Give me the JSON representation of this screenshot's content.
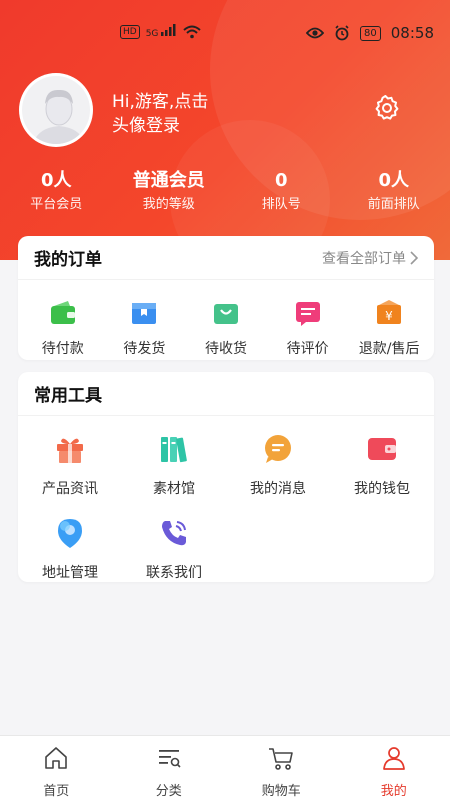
{
  "status_bar": {
    "time": "08:58",
    "left_badge": "HD",
    "signal_label": "5G",
    "battery": "80",
    "icons": [
      "eye-icon",
      "alarm-icon",
      "battery-icon",
      "wifi-icon",
      "signal-icon"
    ]
  },
  "profile": {
    "greeting_line1": "Hi,游客,点击",
    "greeting_line2": "头像登录"
  },
  "stats": [
    {
      "value": "0人",
      "label": "平台会员"
    },
    {
      "value": "普通会员",
      "label": "我的等级"
    },
    {
      "value": "0",
      "label": "排队号"
    },
    {
      "value": "0人",
      "label": "前面排队"
    }
  ],
  "orders": {
    "title": "我的订单",
    "view_all": "查看全部订单",
    "items": [
      {
        "label": "待付款",
        "icon": "wallet-icon",
        "color": "#3cbf4a"
      },
      {
        "label": "待发货",
        "icon": "box-icon",
        "color": "#3a8ff0"
      },
      {
        "label": "待收货",
        "icon": "bag-icon",
        "color": "#44c28a"
      },
      {
        "label": "待评价",
        "icon": "comment-icon",
        "color": "#ef3d7a"
      },
      {
        "label": "退款/售后",
        "icon": "refund-icon",
        "color": "#f0831e"
      }
    ]
  },
  "tools": {
    "title": "常用工具",
    "items": [
      {
        "label": "产品资讯",
        "icon": "gift-icon",
        "color": "#f26a4a"
      },
      {
        "label": "素材馆",
        "icon": "books-icon",
        "color": "#2ec4a6"
      },
      {
        "label": "我的消息",
        "icon": "message-icon",
        "color": "#f2a33a"
      },
      {
        "label": "我的钱包",
        "icon": "wallet-icon",
        "color": "#ef4a5a"
      },
      {
        "label": "地址管理",
        "icon": "location-icon",
        "color": "#3a9ef5"
      },
      {
        "label": "联系我们",
        "icon": "phone-icon",
        "color": "#6a5ad8"
      }
    ]
  },
  "tabbar": {
    "active": "我的",
    "items": [
      {
        "label": "首页",
        "icon": "home-icon"
      },
      {
        "label": "分类",
        "icon": "category-icon"
      },
      {
        "label": "购物车",
        "icon": "cart-icon"
      },
      {
        "label": "我的",
        "icon": "user-icon"
      }
    ]
  },
  "colors": {
    "accent": "#e53a2c",
    "hero": "#f03a2c",
    "background": "#f5f5f7"
  }
}
